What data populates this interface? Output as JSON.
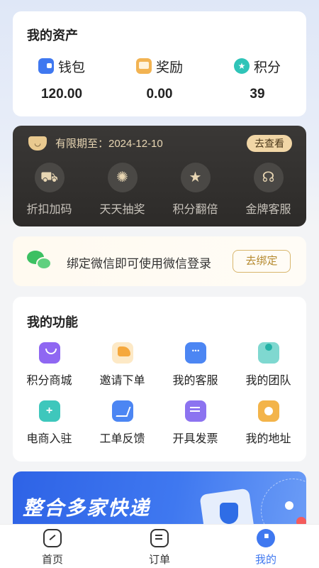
{
  "assets": {
    "title": "我的资产",
    "items": [
      {
        "label": "钱包",
        "value": "120.00",
        "icon": "wallet-icon"
      },
      {
        "label": "奖励",
        "value": "0.00",
        "icon": "reward-icon"
      },
      {
        "label": "积分",
        "value": "39",
        "icon": "points-icon"
      }
    ]
  },
  "vip": {
    "expiry_text": "有限期至：2024-12-10",
    "view_button": "去查看",
    "items": [
      {
        "label": "折扣加码",
        "icon": "scooter-icon"
      },
      {
        "label": "天天抽奖",
        "icon": "wheel-icon"
      },
      {
        "label": "积分翻倍",
        "icon": "star-icon"
      },
      {
        "label": "金牌客服",
        "icon": "headset-icon"
      }
    ]
  },
  "wechat": {
    "text": "绑定微信即可使用微信登录",
    "button": "去绑定"
  },
  "functions": {
    "title": "我的功能",
    "items": [
      {
        "label": "积分商城",
        "icon": "mall-bag-icon"
      },
      {
        "label": "邀请下单",
        "icon": "share-icon"
      },
      {
        "label": "我的客服",
        "icon": "chat-icon"
      },
      {
        "label": "我的团队",
        "icon": "team-icon"
      },
      {
        "label": "电商入驻",
        "icon": "shop-icon"
      },
      {
        "label": "工单反馈",
        "icon": "feedback-icon"
      },
      {
        "label": "开具发票",
        "icon": "invoice-icon"
      },
      {
        "label": "我的地址",
        "icon": "location-icon"
      }
    ]
  },
  "banner": {
    "text": "整合多家快递"
  },
  "nav": {
    "items": [
      {
        "label": "首页",
        "icon": "home-icon"
      },
      {
        "label": "订单",
        "icon": "order-icon"
      },
      {
        "label": "我的",
        "icon": "profile-icon",
        "active": true
      }
    ],
    "active_color": "#3f78f0"
  }
}
